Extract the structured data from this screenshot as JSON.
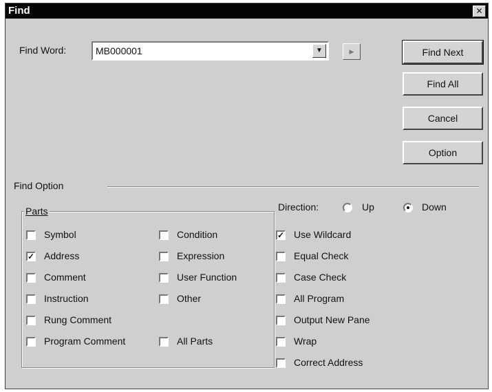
{
  "window": {
    "title": "Find",
    "close_glyph": "✕"
  },
  "find_word": {
    "label": "Find Word:",
    "value": "MB000001"
  },
  "buttons": {
    "find_next": "Find Next",
    "find_all": "Find All",
    "cancel": "Cancel",
    "option": "Option"
  },
  "find_option": {
    "title": "Find Option"
  },
  "parts": {
    "title": "Parts",
    "items": {
      "symbol": {
        "label": "Symbol",
        "checked": false
      },
      "condition": {
        "label": "Condition",
        "checked": false
      },
      "address": {
        "label": "Address",
        "checked": true
      },
      "expression": {
        "label": "Expression",
        "checked": false
      },
      "comment": {
        "label": "Comment",
        "checked": false
      },
      "user_function": {
        "label": "User Function",
        "checked": false
      },
      "instruction": {
        "label": "Instruction",
        "checked": false
      },
      "other": {
        "label": "Other",
        "checked": false
      },
      "rung_comment": {
        "label": "Rung Comment",
        "checked": false
      },
      "program_comment": {
        "label": "Program Comment",
        "checked": false
      },
      "all_parts": {
        "label": "All Parts",
        "checked": false
      }
    }
  },
  "direction": {
    "label": "Direction:",
    "up": {
      "label": "Up",
      "selected": false
    },
    "down": {
      "label": "Down",
      "selected": true
    }
  },
  "options": {
    "use_wildcard": {
      "label": "Use Wildcard",
      "checked": true
    },
    "equal_check": {
      "label": "Equal Check",
      "checked": false
    },
    "case_check": {
      "label": "Case Check",
      "checked": false
    },
    "all_program": {
      "label": "All Program",
      "checked": false
    },
    "output_new_pane": {
      "label": "Output New Pane",
      "checked": false
    },
    "wrap": {
      "label": "Wrap",
      "checked": false
    },
    "correct_address": {
      "label": "Correct Address",
      "checked": false
    }
  }
}
